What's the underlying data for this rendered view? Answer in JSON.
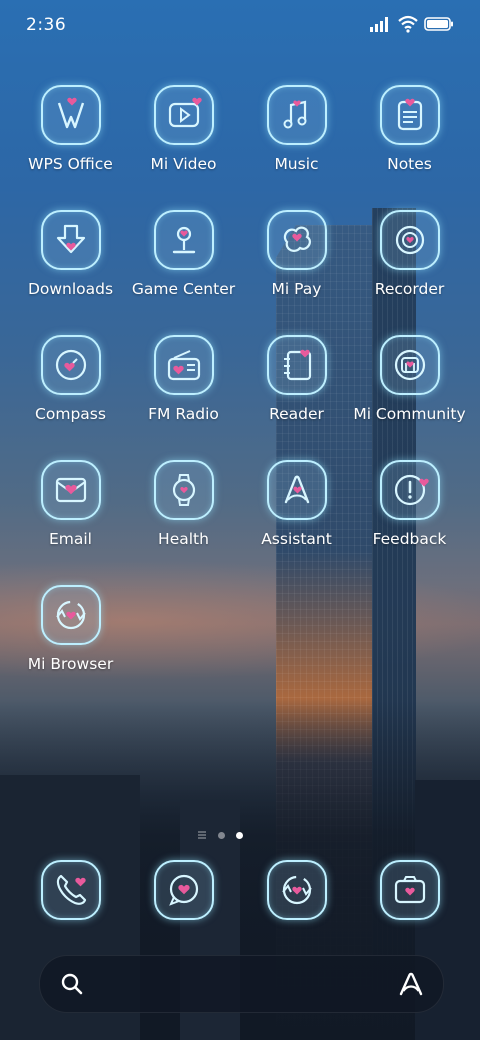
{
  "status_bar": {
    "time": "2:36"
  },
  "apps": [
    {
      "label": "WPS Office",
      "icon": "wps-office-icon"
    },
    {
      "label": "Mi Video",
      "icon": "play-icon"
    },
    {
      "label": "Music",
      "icon": "music-note-icon"
    },
    {
      "label": "Notes",
      "icon": "notes-icon"
    },
    {
      "label": "Downloads",
      "icon": "download-arrow-icon"
    },
    {
      "label": "Game Center",
      "icon": "joystick-icon"
    },
    {
      "label": "Mi Pay",
      "icon": "mi-pay-icon"
    },
    {
      "label": "Recorder",
      "icon": "record-icon"
    },
    {
      "label": "Compass",
      "icon": "compass-icon"
    },
    {
      "label": "FM Radio",
      "icon": "radio-icon"
    },
    {
      "label": "Reader",
      "icon": "book-icon"
    },
    {
      "label": "Mi Community",
      "icon": "community-icon"
    },
    {
      "label": "Email",
      "icon": "envelope-icon"
    },
    {
      "label": "Health",
      "icon": "watch-icon"
    },
    {
      "label": "Assistant",
      "icon": "assistant-icon"
    },
    {
      "label": "Feedback",
      "icon": "exclamation-icon"
    },
    {
      "label": "Mi Browser",
      "icon": "browser-icon"
    }
  ],
  "dock": [
    {
      "icon": "phone-icon"
    },
    {
      "icon": "message-bubble-icon"
    },
    {
      "icon": "browser-icon"
    },
    {
      "icon": "camera-icon"
    }
  ],
  "pager": {
    "pages": 2,
    "current": 2
  },
  "colors": {
    "accent_heart": "#e85a9c",
    "icon_outline": "#bdefff"
  }
}
